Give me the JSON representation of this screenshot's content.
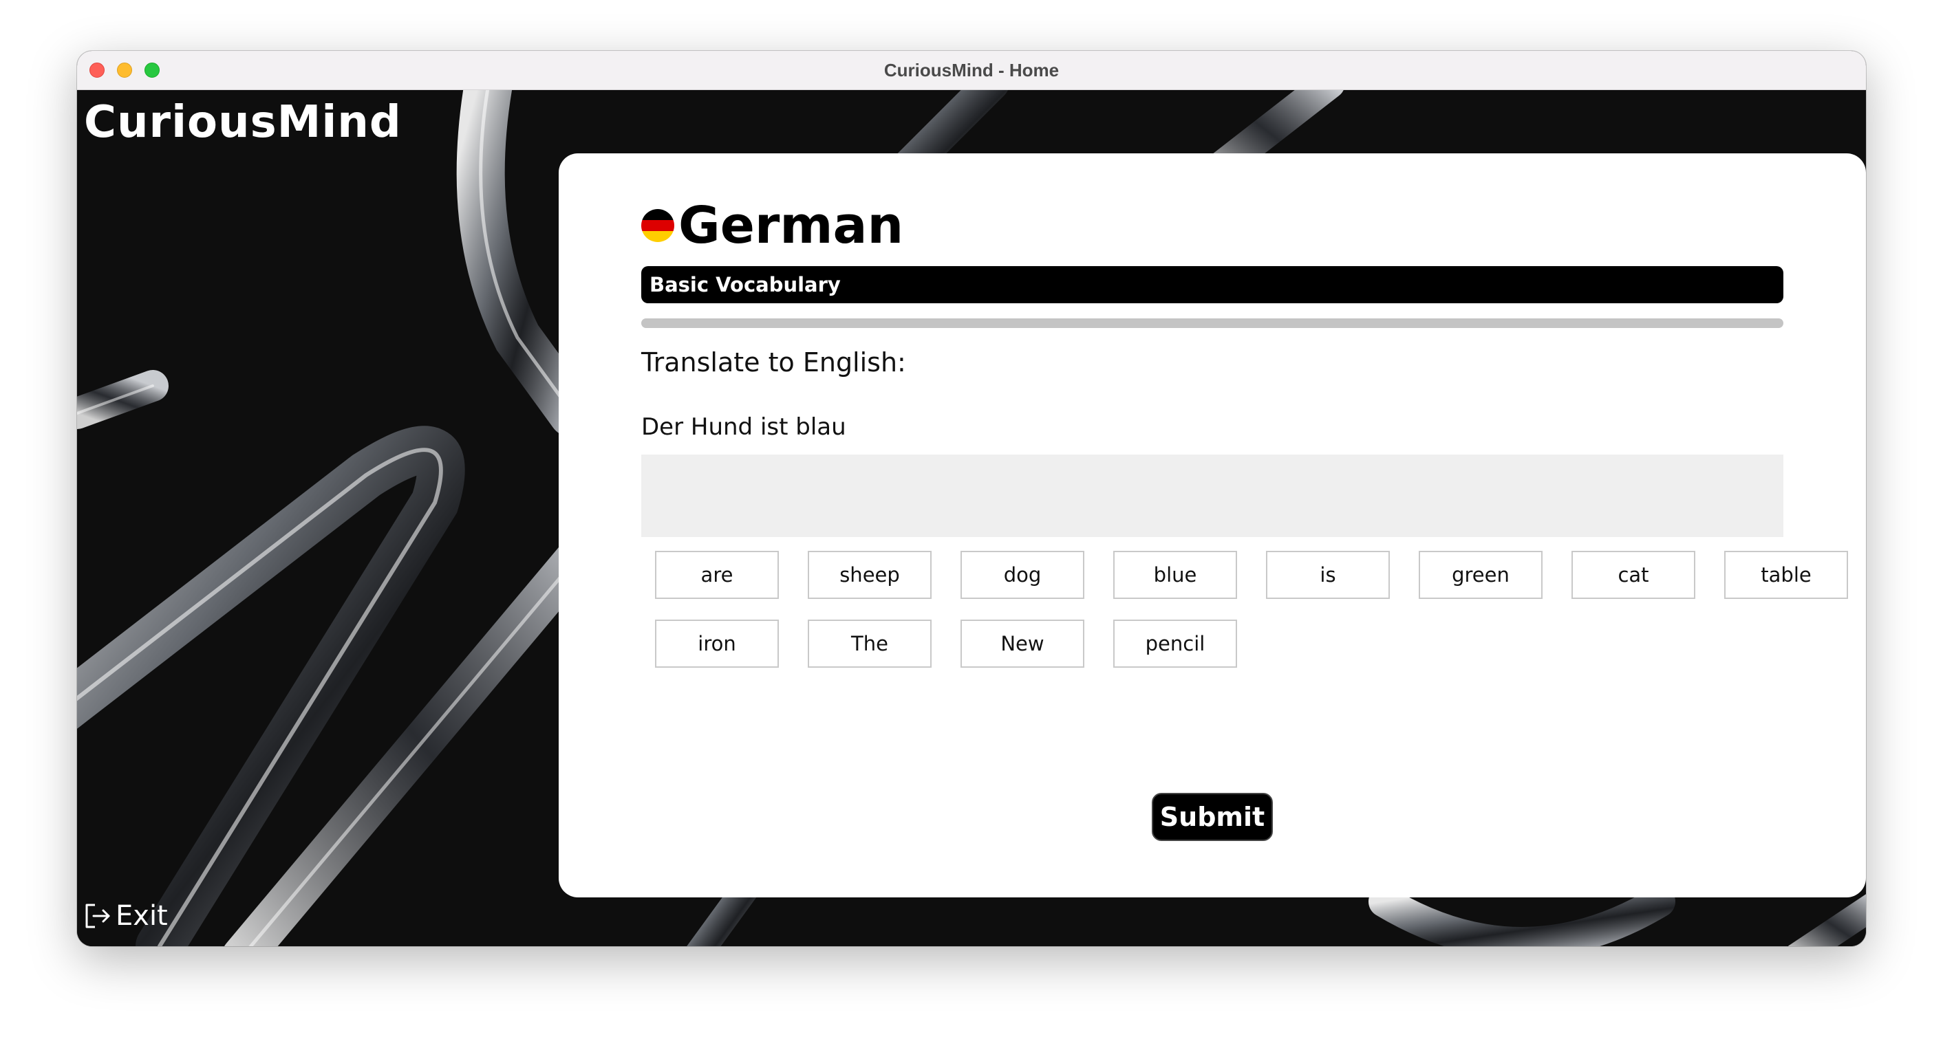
{
  "window": {
    "title": "CuriousMind - Home"
  },
  "app": {
    "brand": "CuriousMind",
    "exit_label": "Exit"
  },
  "lesson": {
    "language": "German",
    "flag_colors": [
      "#000000",
      "#dd0000",
      "#ffce00"
    ],
    "level": "Basic Vocabulary",
    "progress": 0,
    "instruction": "Translate to English:",
    "sentence": "Der Hund ist blau",
    "answer": "",
    "word_bank": [
      "are",
      "sheep",
      "dog",
      "blue",
      "is",
      "green",
      "cat",
      "table",
      "iron",
      "The",
      "New",
      "pencil"
    ],
    "submit_label": "Submit"
  },
  "colors": {
    "accent": "#000000",
    "card": "#ffffff",
    "answer_area": "#efefef",
    "progress_track": "#c4c4c4"
  }
}
